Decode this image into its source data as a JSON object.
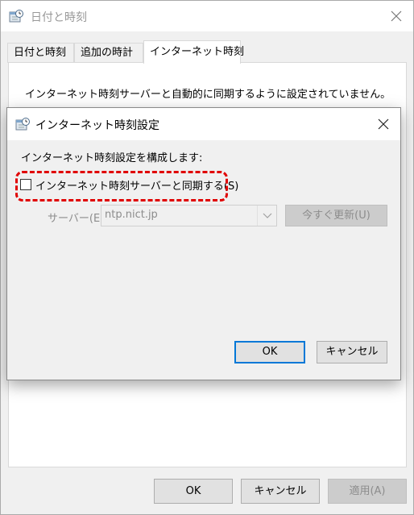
{
  "outer_window": {
    "title": "日付と時刻",
    "tabs": [
      "日付と時刻",
      "追加の時計",
      "インターネット時刻"
    ],
    "message": "インターネット時刻サーバーと自動的に同期するように設定されていません。",
    "buttons": {
      "ok": "OK",
      "cancel": "キャンセル",
      "apply": "適用(A)"
    }
  },
  "dialog": {
    "title": "インターネット時刻設定",
    "heading": "インターネット時刻設定を構成します:",
    "sync_checkbox": {
      "label": "インターネット時刻サーバーと同期する(S)",
      "checked": false
    },
    "server": {
      "label": "サーバー(E):",
      "value": "ntp.nict.jp"
    },
    "update_now_label": "今すぐ更新(U)",
    "buttons": {
      "ok": "OK",
      "cancel": "キャンセル"
    }
  },
  "colors": {
    "highlight": "#e00000",
    "default_button_border": "#0078d7",
    "disabled_text": "#8c8c8c"
  },
  "icons": [
    "clock-calendar-icon",
    "close-icon",
    "chevron-down-icon"
  ]
}
